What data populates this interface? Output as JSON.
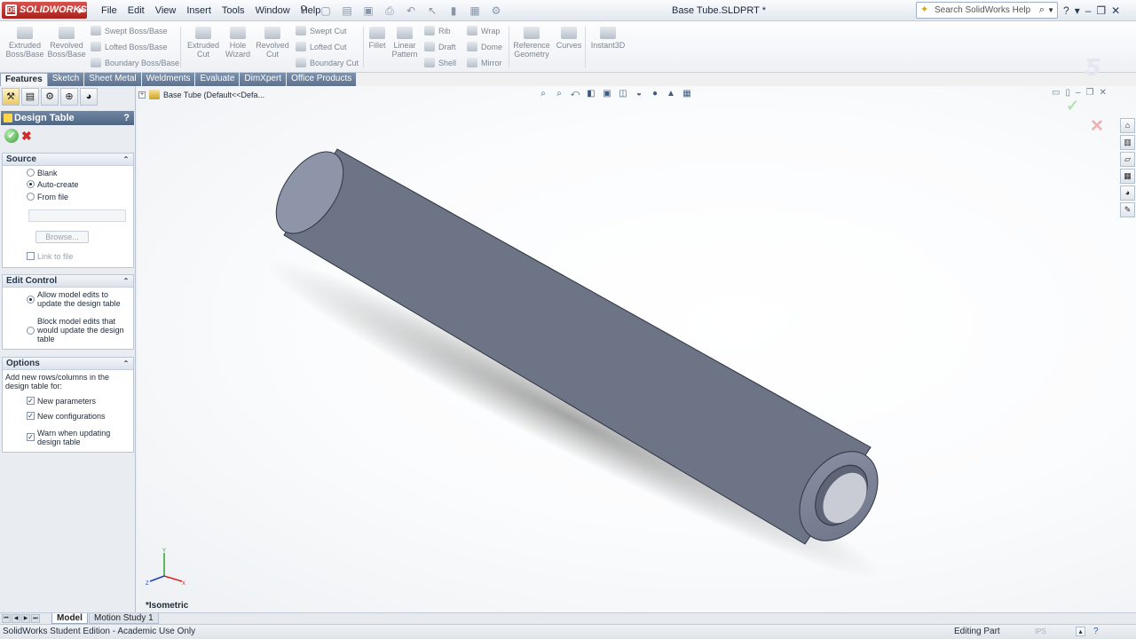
{
  "app": {
    "logo": "SOLIDWORKS",
    "document_title": "Base Tube.SLDPRT *"
  },
  "menu": [
    "File",
    "Edit",
    "View",
    "Insert",
    "Tools",
    "Window",
    "Help"
  ],
  "search": {
    "placeholder": "Search SolidWorks Help"
  },
  "command_manager": {
    "extruded_boss": "Extruded Boss/Base",
    "revolved_boss": "Revolved Boss/Base",
    "swept_boss": "Swept Boss/Base",
    "lofted_boss": "Lofted Boss/Base",
    "boundary_boss": "Boundary Boss/Base",
    "extruded_cut": "Extruded Cut",
    "hole_wizard": "Hole Wizard",
    "revolved_cut": "Revolved Cut",
    "swept_cut": "Swept Cut",
    "lofted_cut": "Lofted Cut",
    "boundary_cut": "Boundary Cut",
    "fillet": "Fillet",
    "linear_pattern": "Linear Pattern",
    "rib": "Rib",
    "draft": "Draft",
    "shell": "Shell",
    "wrap": "Wrap",
    "dome": "Dome",
    "mirror": "Mirror",
    "reference_geometry": "Reference Geometry",
    "curves": "Curves",
    "instant3d": "Instant3D"
  },
  "tabs": [
    "Features",
    "Sketch",
    "Sheet Metal",
    "Weldments",
    "Evaluate",
    "DimXpert",
    "Office Products"
  ],
  "property_manager": {
    "title": "Design Table",
    "help": "?",
    "source": {
      "heading": "Source",
      "blank": "Blank",
      "auto_create": "Auto-create",
      "from_file": "From file",
      "browse": "Browse...",
      "link_to_file": "Link to file",
      "selected": "Auto-create"
    },
    "edit_control": {
      "heading": "Edit Control",
      "allow": "Allow model edits to update the design table",
      "block": "Block model edits that would update the design table",
      "selected": "allow"
    },
    "options": {
      "heading": "Options",
      "description": "Add new rows/columns in the design table for:",
      "new_parameters": "New parameters",
      "new_configurations": "New configurations",
      "warn_when_updating": "Warn when updating design table",
      "checked": {
        "new_parameters": true,
        "new_configurations": true,
        "warn_when_updating": true
      }
    }
  },
  "feature_tree": {
    "root": "Base Tube  (Default<<Defa..."
  },
  "graphics": {
    "view_orientation": "*Isometric",
    "tube_color": "#7e8597"
  },
  "bottom_tabs": [
    "Model",
    "Motion Study 1"
  ],
  "status": {
    "left": "SolidWorks Student Edition - Academic Use Only",
    "mode": "Editing Part",
    "units": "IPS"
  }
}
